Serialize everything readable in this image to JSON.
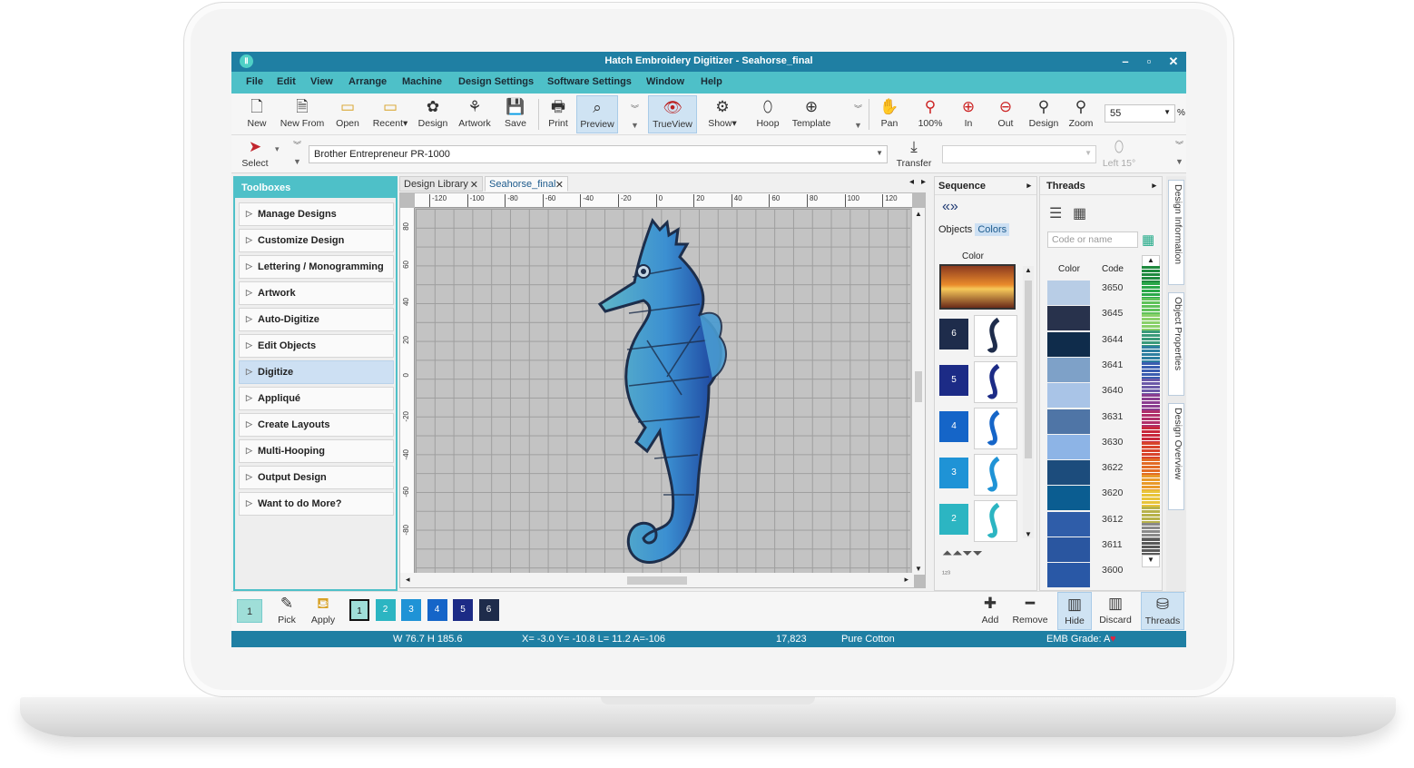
{
  "window": {
    "title": "Hatch Embroidery Digitizer  - Seahorse_final"
  },
  "menu": [
    "File",
    "Edit",
    "View",
    "Arrange",
    "Machine",
    "Design Settings",
    "Software Settings",
    "Window",
    "Help"
  ],
  "toolbar": {
    "new": "New",
    "new_from": "New From",
    "open": "Open",
    "recent": "Recent",
    "design": "Design",
    "artwork": "Artwork",
    "save": "Save",
    "print": "Print",
    "preview": "Preview",
    "trueview": "TrueView",
    "show": "Show",
    "hoop": "Hoop",
    "template": "Template",
    "pan": "Pan",
    "zoom100": "100%",
    "zoom_in": "In",
    "zoom_out": "Out",
    "zoom_design": "Design",
    "zoom": "Zoom",
    "zoom_value": "55",
    "percent": "%"
  },
  "toolbar2": {
    "select": "Select",
    "machine": "Brother Entrepreneur PR-1000",
    "transfer": "Transfer",
    "left15": "Left 15°"
  },
  "toolboxes": {
    "title": "Toolboxes",
    "items": [
      "Manage Designs",
      "Customize Design",
      "Lettering / Monogramming",
      "Artwork",
      "Auto-Digitize",
      "Edit Objects",
      "Digitize",
      "Appliqué",
      "Create Layouts",
      "Multi-Hooping",
      "Output Design",
      "Want to do More?"
    ]
  },
  "tabs": [
    "Design Library",
    "Seahorse_final"
  ],
  "ruler_h": [
    "-120",
    "-100",
    "-80",
    "-60",
    "-40",
    "-20",
    "0",
    "20",
    "40",
    "60",
    "80",
    "100",
    "120"
  ],
  "ruler_v": [
    "80",
    "60",
    "40",
    "20",
    "0",
    "-20",
    "-40",
    "-60",
    "-80"
  ],
  "sequence": {
    "title": "Sequence",
    "objects": "Objects",
    "colors": "Colors",
    "color_label": "Color",
    "items": [
      {
        "num": "6",
        "color": "#1e2c4b"
      },
      {
        "num": "5",
        "color": "#1c2b86"
      },
      {
        "num": "4",
        "color": "#1565c8"
      },
      {
        "num": "3",
        "color": "#1f93d6"
      },
      {
        "num": "2",
        "color": "#2cb5c2"
      }
    ]
  },
  "threads": {
    "title": "Threads",
    "search_placeholder": "Code or name",
    "col_color": "Color",
    "col_code": "Code",
    "rows": [
      {
        "code": "3650",
        "color": "#b8cde6"
      },
      {
        "code": "3645",
        "color": "#28324c"
      },
      {
        "code": "3644",
        "color": "#0f2c4b"
      },
      {
        "code": "3641",
        "color": "#7ea1c8"
      },
      {
        "code": "3640",
        "color": "#a9c4e7"
      },
      {
        "code": "3631",
        "color": "#4f75a6"
      },
      {
        "code": "3630",
        "color": "#8db4e6"
      },
      {
        "code": "3622",
        "color": "#1c4c7c"
      },
      {
        "code": "3620",
        "color": "#0b5d91"
      },
      {
        "code": "3612",
        "color": "#2f5da9"
      },
      {
        "code": "3611",
        "color": "#2a56a0"
      },
      {
        "code": "3600",
        "color": "#2958a6"
      }
    ]
  },
  "sidetabs": [
    "Design Information",
    "Object Properties",
    "Design Overview"
  ],
  "bottom": {
    "current": "1",
    "pick": "Pick",
    "apply": "Apply",
    "swatches": [
      {
        "num": "1",
        "color": "#9fded8"
      },
      {
        "num": "2",
        "color": "#2cb5c2"
      },
      {
        "num": "3",
        "color": "#1f93d6"
      },
      {
        "num": "4",
        "color": "#1565c8"
      },
      {
        "num": "5",
        "color": "#1c2b86"
      },
      {
        "num": "6",
        "color": "#1e2c4b"
      }
    ],
    "add": "Add",
    "remove": "Remove",
    "hide": "Hide",
    "discard": "Discard",
    "threads": "Threads"
  },
  "status": {
    "size": "W  76.7 H 185.6",
    "coords": "X=  -3.0 Y= -10.8 L=  11.2 A=-106",
    "stitches": "17,823",
    "fabric": "Pure Cotton",
    "grade": "EMB Grade: A"
  },
  "colors": {
    "accent": "#4ec0c8",
    "titlebar": "#1f7fa3"
  }
}
